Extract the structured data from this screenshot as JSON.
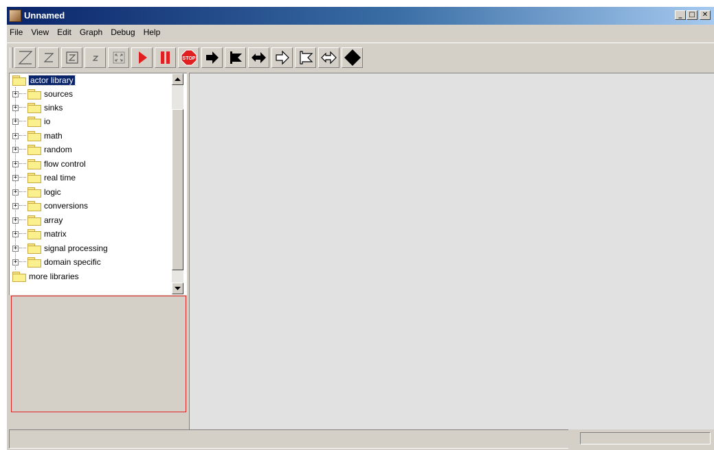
{
  "window": {
    "title": "Unnamed",
    "controls": {
      "minimize": "_",
      "maximize": "□",
      "close": "✕"
    }
  },
  "menu": [
    "File",
    "View",
    "Edit",
    "Graph",
    "Debug",
    "Help"
  ],
  "toolbar": {
    "buttons": [
      {
        "icon": "zoom-reset-icon"
      },
      {
        "icon": "zoom-in-icon"
      },
      {
        "icon": "zoom-fit-icon"
      },
      {
        "icon": "zoom-out-icon"
      },
      {
        "icon": "full-screen-icon"
      },
      {
        "icon": "run-icon"
      },
      {
        "icon": "pause-icon"
      },
      {
        "icon": "stop-icon",
        "text": "STOP"
      },
      {
        "icon": "arrow-right-black-icon"
      },
      {
        "icon": "flag-black-icon"
      },
      {
        "icon": "double-arrow-black-icon"
      },
      {
        "icon": "arrow-right-white-icon"
      },
      {
        "icon": "flag-white-icon"
      },
      {
        "icon": "double-arrow-white-icon"
      },
      {
        "icon": "diamond-black-icon"
      }
    ]
  },
  "library_tree": {
    "root": "actor library",
    "children": [
      "sources",
      "sinks",
      "io",
      "math",
      "random",
      "flow control",
      "real time",
      "logic",
      "conversions",
      "array",
      "matrix",
      "signal processing",
      "domain specific"
    ],
    "sibling": "more libraries"
  },
  "status": {
    "message": ""
  },
  "colors": {
    "title_start": "#0a246a",
    "title_end": "#a6caf0",
    "run_red": "#e02020",
    "canvas": "#e1e1e1",
    "preview_border": "#e02020"
  }
}
